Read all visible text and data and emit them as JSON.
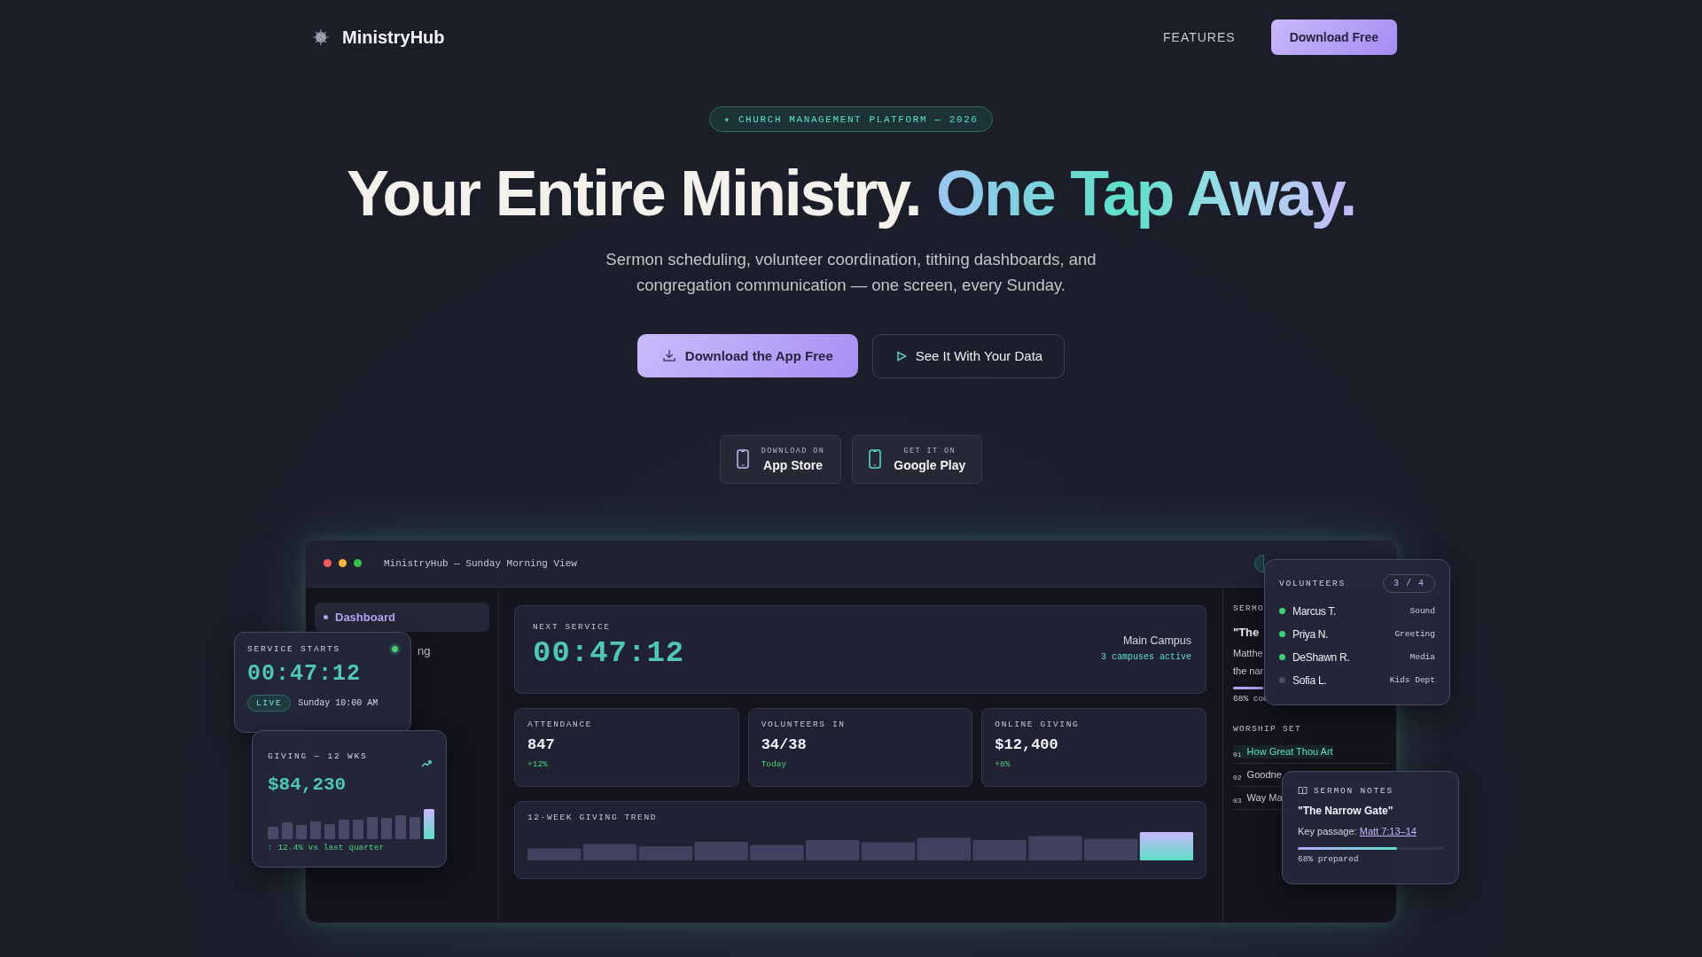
{
  "nav": {
    "brand": "MinistryHub",
    "links": [
      {
        "label": "FEATURES"
      }
    ],
    "cta": "Download Free"
  },
  "hero": {
    "badge": "✦ CHURCH MANAGEMENT PLATFORM — 2026",
    "headline": "Your Entire Ministry.",
    "headline_accent": "One Tap Away.",
    "subtitle": "Sermon scheduling, volunteer coordination, tithing dashboards, and congregation communication — one screen, every Sunday.",
    "primary_button": "Download the App Free",
    "secondary_button": "See It With Your Data",
    "stores": [
      {
        "kind": "apple",
        "caption": "DOWNLOAD ON",
        "name": "App Store"
      },
      {
        "kind": "google",
        "caption": "GET IT ON",
        "name": "Google Play"
      }
    ]
  },
  "dashboard": {
    "title": "MinistryHub — Sunday Morning View",
    "sidebar": [
      {
        "label": "Dashboard",
        "selected": true
      },
      {
        "label": "ng",
        "selected": false
      }
    ],
    "next_service": {
      "label": "NEXT SERVICE",
      "countdown": "00:47:12",
      "campus": "Main Campus",
      "campuses": "3 campuses active"
    },
    "stats": [
      {
        "label": "ATTENDANCE",
        "value": "847",
        "note": "+12%"
      },
      {
        "label": "VOLUNTEERS IN",
        "value": "34/38",
        "note": "Today"
      },
      {
        "label": "ONLINE GIVING",
        "value": "$12,400",
        "note": "+8%"
      }
    ],
    "trend": {
      "title": "12-WEEK GIVING TREND"
    },
    "side_panel": {
      "label": "SERMO",
      "title": "\"The",
      "description_lines": [
        "Matthe",
        "the nar"
      ],
      "level": 0.68,
      "progress_note": "68% com",
      "worship_label": "WORSHIP SET",
      "worship": [
        {
          "number": "01",
          "title": "How Great Thou Art",
          "selected": true
        },
        {
          "number": "02",
          "title": "Goodne",
          "selected": false
        },
        {
          "number": "03",
          "title": "Way Ma",
          "selected": false
        }
      ]
    }
  },
  "service_card": {
    "label": "SERVICE STARTS",
    "countdown": "00:47:12",
    "status": "LIVE",
    "time": "Sunday 10:00 AM"
  },
  "giving_card": {
    "label": "GIVING — 12 WKS",
    "amount": "$84,230",
    "change": "↑ 12.4% vs last quarter"
  },
  "volunteers_card": {
    "label": "VOLUNTEERS",
    "count": "3 / 4",
    "people": [
      {
        "name": "Marcus T.",
        "role": "Sound",
        "checked_in": true
      },
      {
        "name": "Priya N.",
        "role": "Greeting",
        "checked_in": true
      },
      {
        "name": "DeShawn R.",
        "role": "Media",
        "checked_in": true
      },
      {
        "name": "Sofia L.",
        "role": "Kids Dept",
        "checked_in": false
      }
    ]
  },
  "notes_card": {
    "label": "SERMON NOTES",
    "title": "\"The Narrow Gate\"",
    "passage_label": "Key passage:",
    "passage_link": "Matt 7:13–14",
    "level": 0.68,
    "progress_text": "68% prepared"
  }
}
